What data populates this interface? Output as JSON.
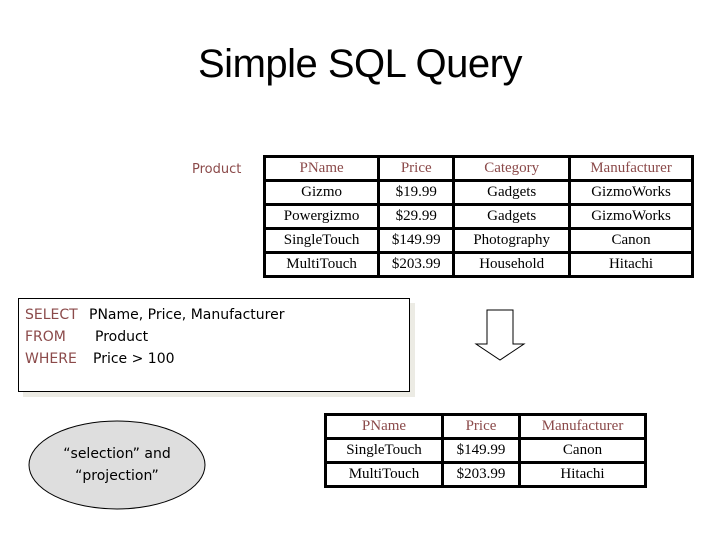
{
  "title": "Simple SQL Query",
  "input_relation": {
    "name": "Product",
    "columns": [
      "PName",
      "Price",
      "Category",
      "Manufacturer"
    ],
    "rows": [
      [
        "Gizmo",
        "$19.99",
        "Gadgets",
        "GizmoWorks"
      ],
      [
        "Powergizmo",
        "$29.99",
        "Gadgets",
        "GizmoWorks"
      ],
      [
        "SingleTouch",
        "$149.99",
        "Photography",
        "Canon"
      ],
      [
        "MultiTouch",
        "$203.99",
        "Household",
        "Hitachi"
      ]
    ]
  },
  "query": {
    "select_kw": "SELECT",
    "select_val": "PName, Price, Manufacturer",
    "from_kw": "FROM",
    "from_val": "Product",
    "where_kw": "WHERE",
    "where_val": "Price > 100"
  },
  "arrow_icon": "down-arrow",
  "callout": {
    "line1": "“selection” and",
    "line2": "“projection”"
  },
  "result_relation": {
    "columns": [
      "PName",
      "Price",
      "Manufacturer"
    ],
    "rows": [
      [
        "SingleTouch",
        "$149.99",
        "Canon"
      ],
      [
        "MultiTouch",
        "$203.99",
        "Hitachi"
      ]
    ]
  },
  "colors": {
    "keyword": "#8b4a4a",
    "ellipse_fill": "#dedede"
  }
}
